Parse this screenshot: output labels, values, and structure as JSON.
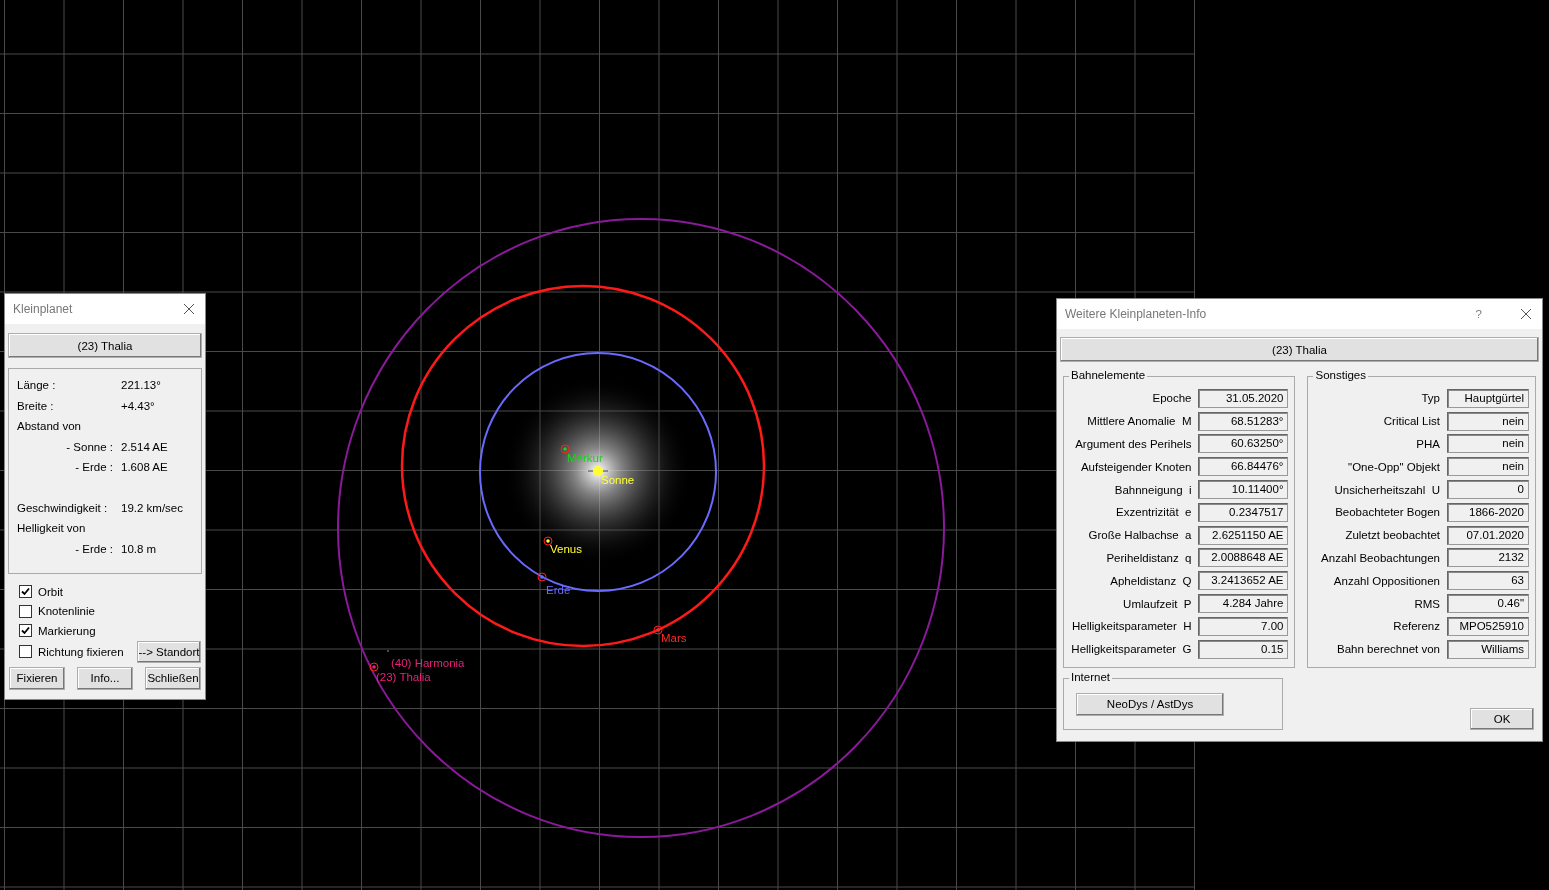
{
  "map": {
    "orbits": [
      {
        "color": "#6a6aff"
      },
      {
        "color": "#ff1a1a"
      },
      {
        "color": "#8a1a9a"
      }
    ],
    "bodies": [
      {
        "label": "Merkur",
        "color": "#1fd01f"
      },
      {
        "label": "Sonne",
        "color": "#ffff33"
      },
      {
        "label": "Venus",
        "color": "#ffff33"
      },
      {
        "label": "Erde",
        "color": "#6a6aff"
      },
      {
        "label": "Mars",
        "color": "#ff2a2a"
      },
      {
        "label": "(40) Harmonia",
        "color": "#e8207a"
      },
      {
        "label": "(23) Thalia",
        "color": "#e8207a"
      }
    ]
  },
  "small_body_window": {
    "title": "Kleinplanet",
    "object": "(23) Thalia",
    "rows": [
      {
        "kind": "row",
        "label": "Länge :",
        "value": "221.13°"
      },
      {
        "kind": "row",
        "label": "Breite :",
        "value": "+4.43°"
      },
      {
        "kind": "heading",
        "label": "Abstand von"
      },
      {
        "kind": "sub",
        "label": "-  Sonne :",
        "value": "2.514 AE"
      },
      {
        "kind": "sub",
        "label": "-  Erde :",
        "value": "1.608 AE"
      },
      {
        "kind": "row",
        "label": "Geschwindigkeit :",
        "value": "19.2 km/sec"
      },
      {
        "kind": "heading",
        "label": "Helligkeit von"
      },
      {
        "kind": "sub",
        "label": "-  Erde :",
        "value": "10.8 m"
      }
    ],
    "options": [
      {
        "label": "Orbit",
        "checked": true
      },
      {
        "label": "Knotenlinie",
        "checked": false
      },
      {
        "label": "Markierung",
        "checked": true
      },
      {
        "label": "Richtung fixieren",
        "checked": false
      }
    ],
    "side_button": "--> Standort",
    "buttons": [
      "Fixieren",
      "Info...",
      "Schließen"
    ]
  },
  "info_window": {
    "title": "Weitere Kleinplaneten-Info",
    "help": "?",
    "object": "(23) Thalia",
    "orbit_elements": {
      "title": "Bahnelemente",
      "rows": [
        {
          "label": "Epoche",
          "value": "31.05.2020"
        },
        {
          "label": "Mittlere Anomalie  M",
          "value": "68.51283°"
        },
        {
          "label": "Argument des Perihels",
          "value": "60.63250°"
        },
        {
          "label": "Aufsteigender Knoten",
          "value": "66.84476°"
        },
        {
          "label": "Bahnneigung  i",
          "value": "10.11400°"
        },
        {
          "label": "Exzentrizität  e",
          "value": "0.2347517"
        },
        {
          "label": "Große Halbachse  a",
          "value": "2.6251150 AE"
        },
        {
          "label": "Periheldistanz  q",
          "value": "2.0088648 AE"
        },
        {
          "label": "Apheldistanz  Q",
          "value": "3.2413652 AE"
        },
        {
          "label": "Umlaufzeit  P",
          "value": "4.284 Jahre"
        },
        {
          "label": "Helligkeitsparameter  H",
          "value": "7.00"
        },
        {
          "label": "Helligkeitsparameter  G",
          "value": "0.15"
        }
      ]
    },
    "other": {
      "title": "Sonstiges",
      "rows": [
        {
          "label": "Typ",
          "value": "Hauptgürtel"
        },
        {
          "label": "Critical List",
          "value": "nein"
        },
        {
          "label": "PHA",
          "value": "nein"
        },
        {
          "label": "\"One-Opp\" Objekt",
          "value": "nein"
        },
        {
          "label": "Unsicherheitszahl  U",
          "value": "0"
        },
        {
          "label": "Beobachteter Bogen",
          "value": "1866-2020"
        },
        {
          "label": "Zuletzt beobachtet",
          "value": "07.01.2020"
        },
        {
          "label": "Anzahl Beobachtungen",
          "value": "2132"
        },
        {
          "label": "Anzahl Oppositionen",
          "value": "63"
        },
        {
          "label": "RMS",
          "value": "0.46\""
        },
        {
          "label": "Referenz",
          "value": "MPO525910"
        },
        {
          "label": "Bahn berechnet von",
          "value": "Williams"
        }
      ]
    },
    "internet": {
      "title": "Internet",
      "button": "NeoDys / AstDys"
    },
    "ok": "OK"
  }
}
